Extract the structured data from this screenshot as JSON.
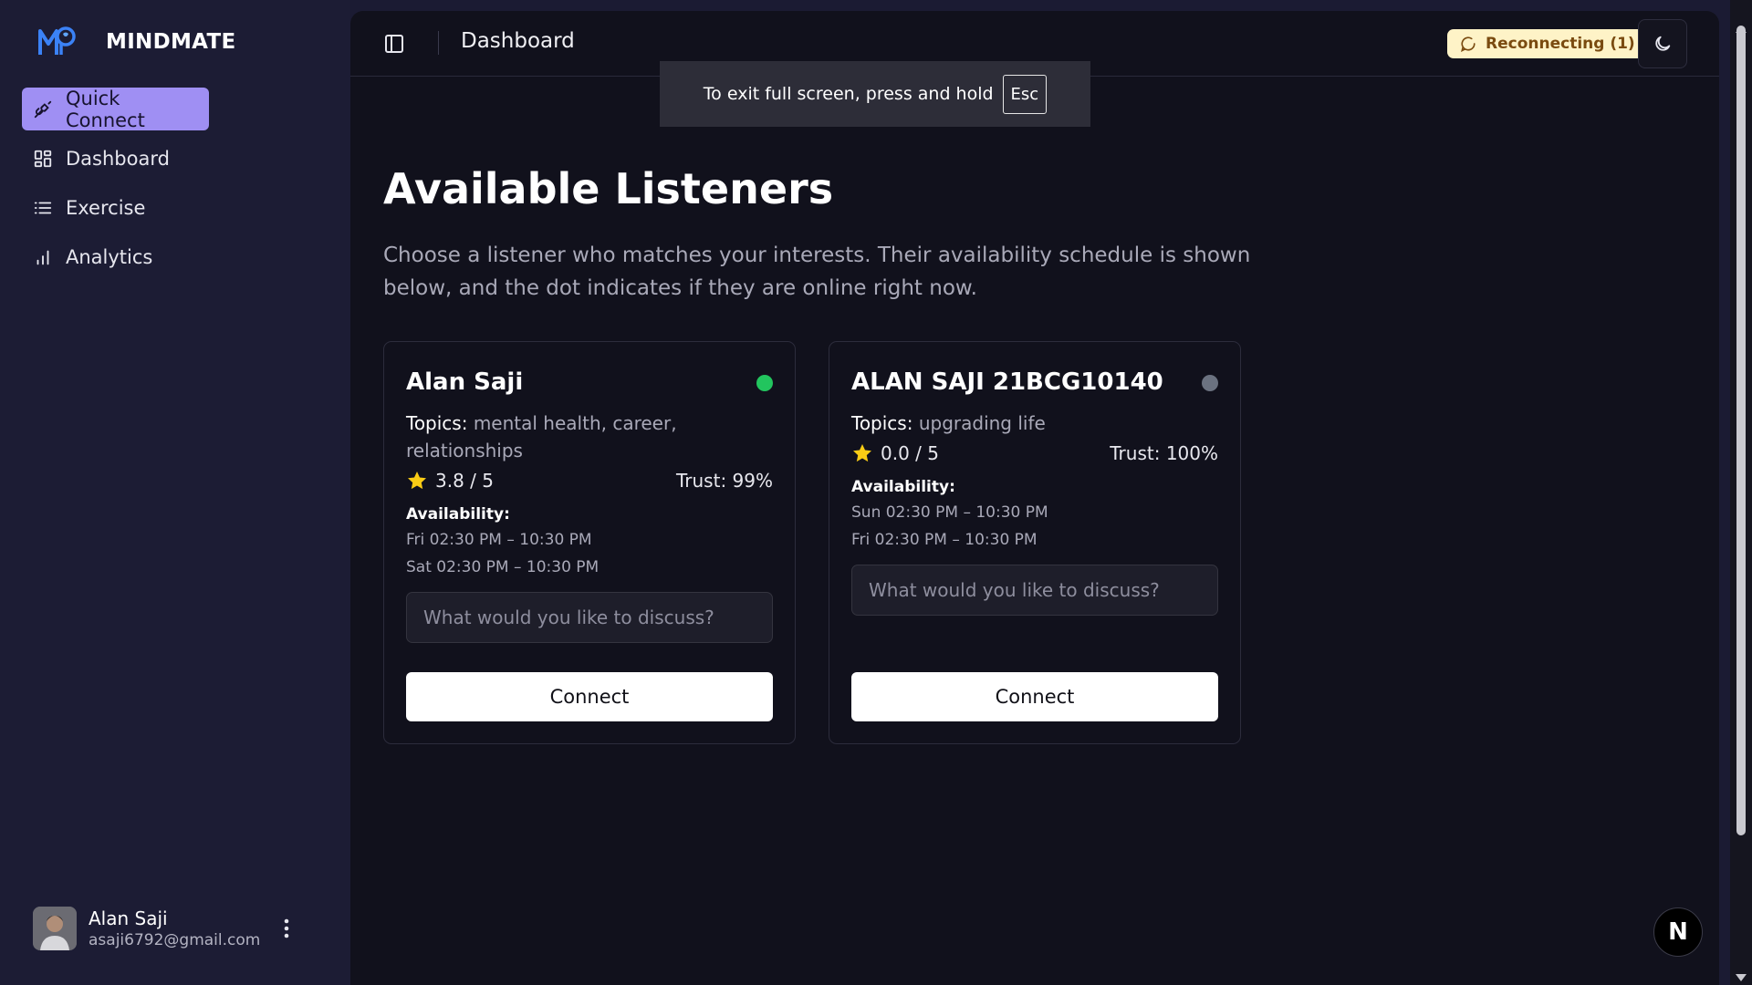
{
  "app": {
    "brand": "MINDMATE"
  },
  "sidebar": {
    "items": [
      {
        "label": "Quick Connect",
        "icon": "plug-icon",
        "active": true
      },
      {
        "label": "Dashboard",
        "icon": "dashboard-icon",
        "active": false
      },
      {
        "label": "Exercise",
        "icon": "list-icon",
        "active": false
      },
      {
        "label": "Analytics",
        "icon": "bar-chart-icon",
        "active": false
      }
    ],
    "user": {
      "name": "Alan Saji",
      "email": "asaji6792@gmail.com"
    }
  },
  "header": {
    "title": "Dashboard",
    "status": "Reconnecting (1)",
    "fullscreen_notice": "To exit full screen, press and hold",
    "fullscreen_key": "Esc"
  },
  "main": {
    "title": "Available Listeners",
    "subtitle": "Choose a listener who matches your interests. Their availability schedule is shown below, and the dot indicates if they are online right now."
  },
  "listeners": [
    {
      "name": "Alan Saji",
      "online": true,
      "topics_label": "Topics:",
      "topics": "mental health, career, relationships",
      "rating": "3.8 / 5",
      "trust": "Trust: 99%",
      "availability_label": "Availability:",
      "availability": [
        "Fri 02:30 PM – 10:30 PM",
        "Sat 02:30 PM – 10:30 PM"
      ],
      "placeholder": "What would you like to discuss?",
      "connect_label": "Connect"
    },
    {
      "name": "ALAN SAJI 21BCG10140",
      "online": false,
      "topics_label": "Topics:",
      "topics": "upgrading life",
      "rating": "0.0 / 5",
      "trust": "Trust: 100%",
      "availability_label": "Availability:",
      "availability": [
        "Sun 02:30 PM – 10:30 PM",
        "Fri 02:30 PM – 10:30 PM"
      ],
      "placeholder": "What would you like to discuss?",
      "connect_label": "Connect"
    }
  ],
  "floating": {
    "badge": "N"
  },
  "colors": {
    "accent": "#9f8ff3",
    "online": "#22c55e",
    "offline": "#6b7280",
    "status_bg": "#fef3c7",
    "star": "#facc15"
  }
}
